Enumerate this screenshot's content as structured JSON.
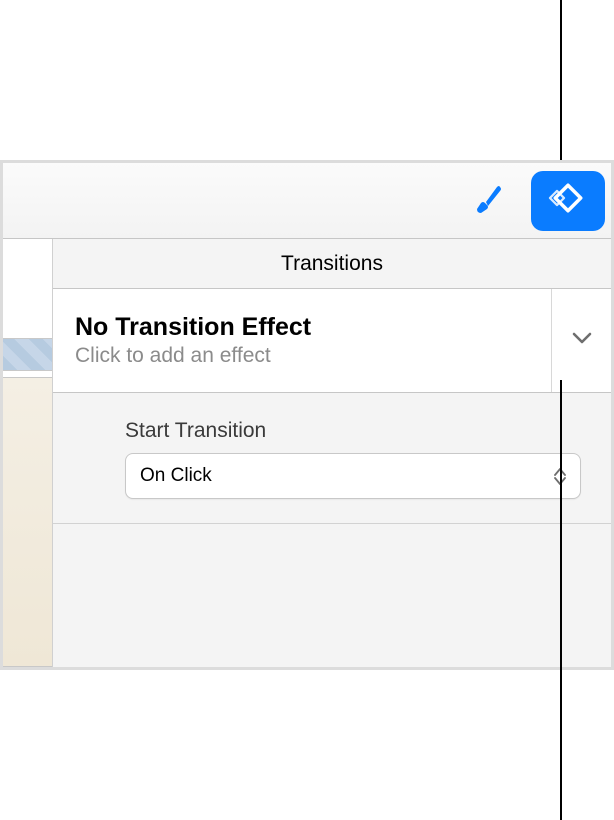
{
  "toolbar": {
    "brush_icon": "brush-icon",
    "animate_icon": "animate-icon"
  },
  "tab": {
    "label": "Transitions"
  },
  "effect": {
    "title": "No Transition Effect",
    "subtitle": "Click to add an effect"
  },
  "start": {
    "label": "Start Transition",
    "value": "On Click"
  }
}
